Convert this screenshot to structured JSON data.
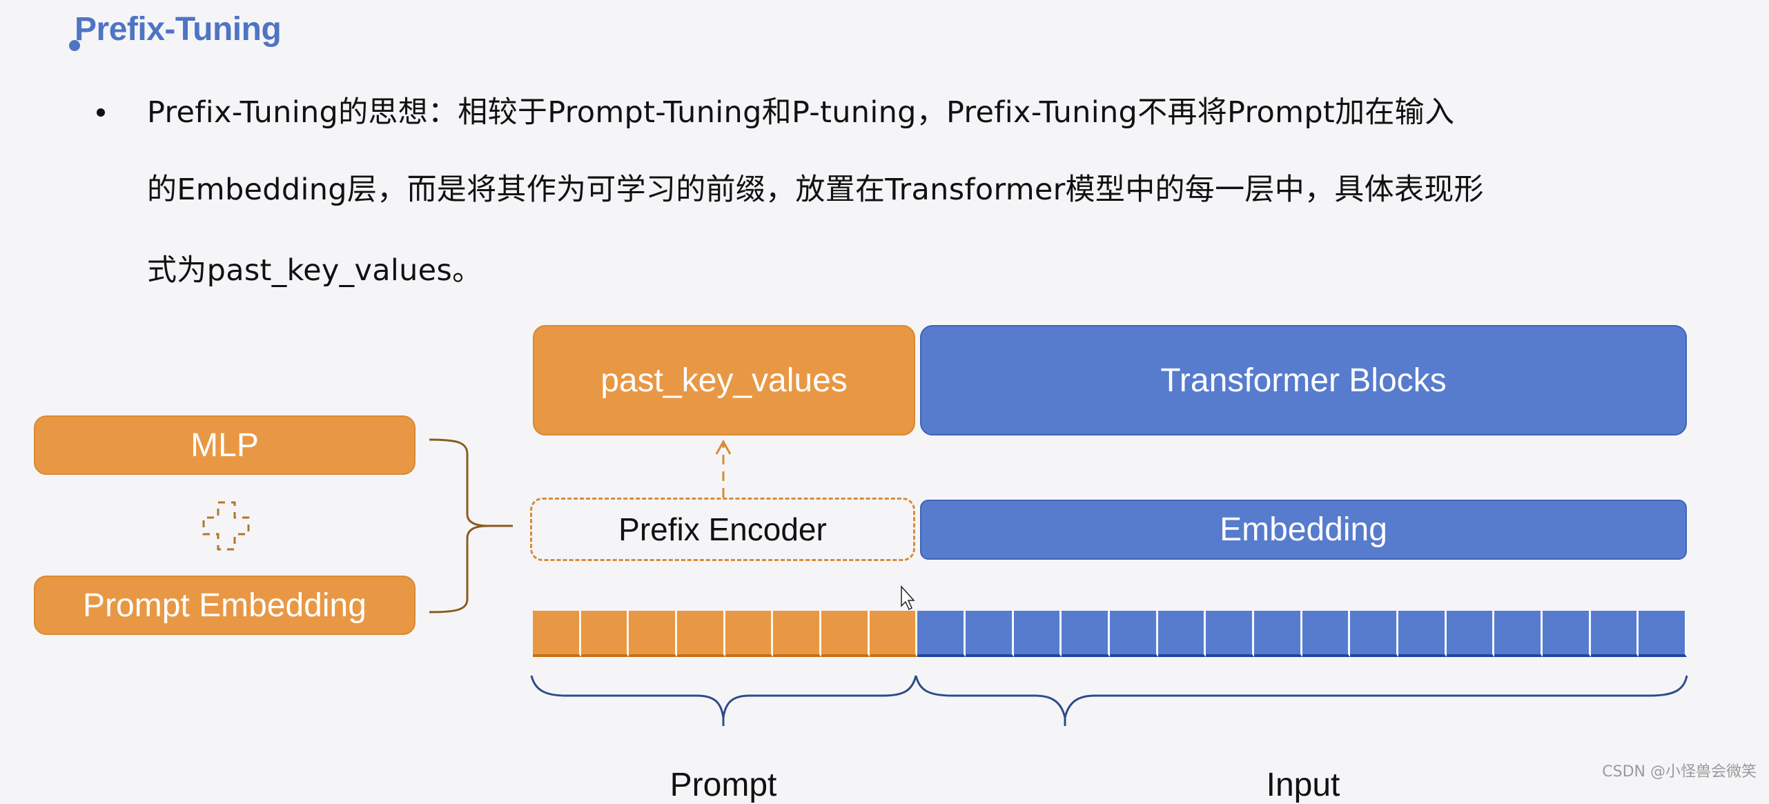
{
  "heading": {
    "title": "Prefix-Tuning",
    "bullet_color": "#4F74C4"
  },
  "paragraph": {
    "lines": [
      "Prefix-Tuning的思想：相较于Prompt-Tuning和P-tuning，Prefix-Tuning不再将Prompt加在输入",
      "的Embedding层，而是将其作为可学习的前缀，放置在Transformer模型中的每一层中，具体表现形",
      "式为past_key_values。"
    ]
  },
  "diagram": {
    "colors": {
      "orange": "#E89845",
      "blue": "#577CCE",
      "bracket_orange": "#8A5A1E",
      "bracket_blue": "#2E4C86"
    },
    "left": {
      "mlp_label": "MLP",
      "plus_icon": "dashed-plus",
      "prompt_embedding_label": "Prompt Embedding"
    },
    "past_key_values_label": "past_key_values",
    "transformer_blocks_label": "Transformer Blocks",
    "prefix_encoder_label": "Prefix Encoder",
    "embedding_label": "Embedding",
    "tokens": {
      "prompt_count": 8,
      "input_count": 16
    },
    "prompt_label": "Prompt",
    "input_label": "Input"
  },
  "watermark": "CSDN @小怪兽会微笑"
}
